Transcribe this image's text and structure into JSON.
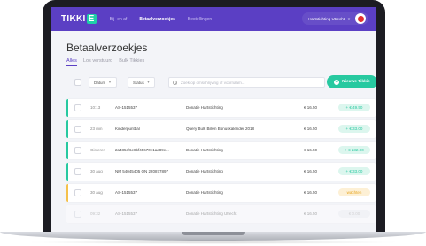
{
  "nav": {
    "logo": "TIKKI",
    "logo_accent": "E",
    "items": [
      {
        "label": "Bij- en af",
        "active": false
      },
      {
        "label": "Betaalverzoekjes",
        "active": true
      },
      {
        "label": "Bestellingen",
        "active": false
      }
    ],
    "org": "Hartstichting Utrecht",
    "colors": {
      "nav": "#5b3fc4",
      "accent": "#27c9a0"
    }
  },
  "page": {
    "title": "Betaalverzoekjes",
    "tabs": [
      {
        "label": "Alles",
        "active": true
      },
      {
        "label": "Los verstuurd",
        "active": false
      },
      {
        "label": "Bulk Tikkies",
        "active": false
      }
    ]
  },
  "filters": {
    "date_label": "Datum",
    "status_label": "Status",
    "search_placeholder": "Zoek op omschrijving of voornaam...",
    "new_button": "Nieuwe Tikkie"
  },
  "rows": [
    {
      "time": "10:13",
      "ref": "AS-1515537",
      "desc": "Donatie Hartstichting",
      "amount": "€ 16.50",
      "status": "+ € 49.50",
      "state": "paid",
      "stripe": "#27c9a0"
    },
    {
      "time": "23 min",
      "ref": "Kinderpuntbal",
      "desc": "Query Bulk Billen Bonuskalender 2018",
      "amount": "€ 16.50",
      "status": "+ € 33.00",
      "state": "paid",
      "stripe": "#27c9a0"
    },
    {
      "time": "Gisteren",
      "ref": "2a485c/6e8bf45670e1ad89c...",
      "desc": "Donatie Hartstichting",
      "amount": "€ 16.50",
      "status": "+ € 132.00",
      "state": "paid",
      "stripe": "#27c9a0"
    },
    {
      "time": "30 aug",
      "ref": "NM 54045405 ON 220877897",
      "desc": "Donatie Hartstichting",
      "amount": "€ 16.50",
      "status": "+ € 33.00",
      "state": "paid",
      "stripe": "#27c9a0"
    },
    {
      "time": "30 aug",
      "ref": "AS-1515537",
      "desc": "Donatie Hartstichting",
      "amount": "€ 16.50",
      "status": "wachten",
      "state": "wait",
      "stripe": "#f5c14b"
    },
    {
      "time": "09:32",
      "ref": "AS-1515537",
      "desc": "Donatie Hartstichting Utrecht",
      "amount": "€ 16.50",
      "status": "€ 0.00",
      "state": "none",
      "stripe": "#ffffff"
    }
  ]
}
